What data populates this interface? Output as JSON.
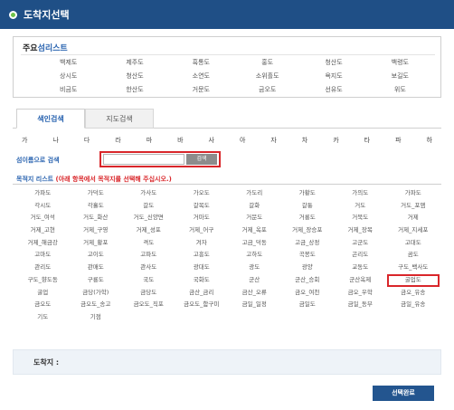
{
  "window": {
    "title": "도착지선택"
  },
  "favorites": {
    "title_part1": "주요",
    "title_part2": "섬리스트",
    "items": [
      "백제도",
      "제주도",
      "흑통도",
      "홍도",
      "청산도",
      "백령도",
      "상시도",
      "청산도",
      "소연도",
      "소위흘도",
      "욕지도",
      "보길도",
      "비금도",
      "한산도",
      "거문도",
      "금오도",
      "선유도",
      "위도"
    ]
  },
  "tabs": [
    {
      "label": "색인검색",
      "active": true
    },
    {
      "label": "지도검색",
      "active": false
    }
  ],
  "consonants": [
    "가",
    "나",
    "다",
    "라",
    "마",
    "바",
    "사",
    "아",
    "자",
    "차",
    "카",
    "타",
    "파",
    "하"
  ],
  "search": {
    "label": "섬이름으로 검색",
    "placeholder": "",
    "button_label": "검색"
  },
  "destinations": {
    "label": "목적지 리스트",
    "note": "(아래 항목에서 목적지를 선택해 주십시오.)",
    "items": [
      "가파도",
      "가덕도",
      "가사도",
      "가오도",
      "가도리",
      "가황도",
      "가의도",
      "가파도",
      "각시도",
      "각흘도",
      "갈도",
      "갈목도",
      "갈화",
      "갈퉁",
      "거도",
      "거도_포앰",
      "거도_여석",
      "거도_화산",
      "거도_신양면",
      "거마도",
      "거문도",
      "거룡도",
      "거북도",
      "거제",
      "거제_고현",
      "거제_구영",
      "거제_성포",
      "거제_어구",
      "거제_옥포",
      "거제_장승포",
      "거제_장목",
      "거제_지세포",
      "거제_해금강",
      "거제_황포",
      "격도",
      "겨자",
      "고금_덕동",
      "고금_상정",
      "고군도",
      "고대도",
      "고마도",
      "고이도",
      "고파도",
      "고흥도",
      "고하도",
      "곡봉도",
      "곤리도",
      "곰도",
      "관리도",
      "관매도",
      "관사도",
      "광대도",
      "광도",
      "광양",
      "교동도",
      "구도_백사도",
      "구도_향도동",
      "구룡도",
      "국도",
      "국화도",
      "군산",
      "군산_승회",
      "군산옥제",
      "굴업도",
      "굴업",
      "금당(가학)",
      "금당도",
      "금산_금리",
      "금산_오류",
      "금오_여천",
      "금오_우학",
      "금오_유송",
      "금오도",
      "금오도_송고",
      "금오도_직포",
      "금오도_함구미",
      "금일_일정",
      "금일도",
      "금일_동부",
      "금일_유송",
      "기도",
      "기점"
    ],
    "selected_index": 63
  },
  "arrival": {
    "label": "도착지 :"
  },
  "done_button": {
    "label": "선택완료"
  },
  "colors": {
    "header": "#1f4f86",
    "accent_blue": "#2a64b0",
    "highlight_red": "#d9262a",
    "title_dot": "#6fc24a",
    "search_button": "#8c8c8c",
    "done_button": "#23558f"
  }
}
